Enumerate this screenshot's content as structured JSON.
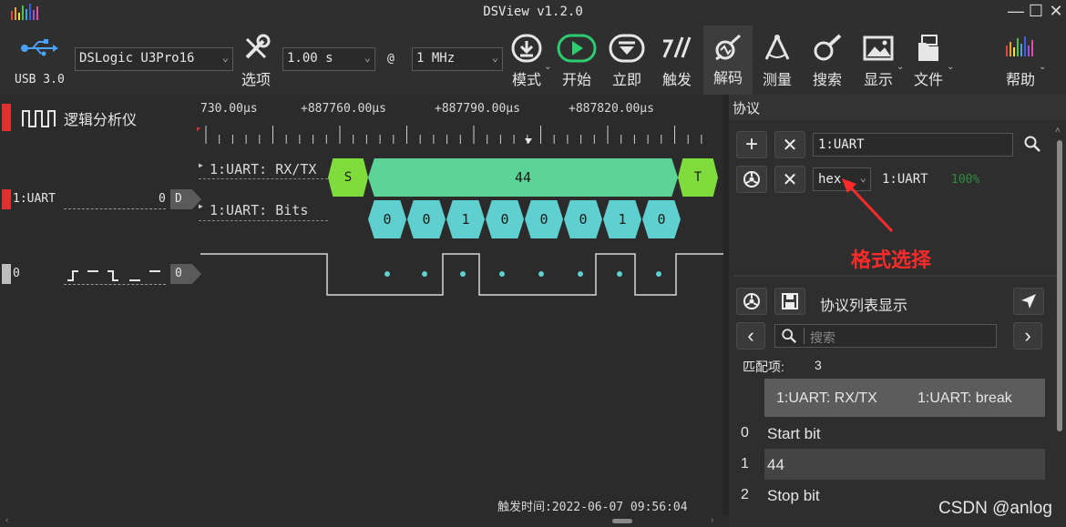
{
  "app": {
    "title": "DSView v1.2.0"
  },
  "toolbar": {
    "usb_label": "USB 3.0",
    "device": "DSLogic U3Pro16",
    "options_label": "选项",
    "duration": "1.00 s",
    "at": "@",
    "rate": "1 MHz",
    "mode_label": "模式",
    "start_label": "开始",
    "instant_label": "立即",
    "trigger_label": "触发",
    "decode_label": "解码",
    "measure_label": "测量",
    "search_label": "搜索",
    "display_label": "显示",
    "file_label": "文件",
    "help_label": "帮助"
  },
  "left": {
    "analyzer_label": "逻辑分析仪",
    "uart_label": "1:UART",
    "uart_value": "0",
    "uart_tag": "D",
    "ch0_label": "0",
    "ch0_tag": "0"
  },
  "ruler": {
    "labels": [
      "730.00μs",
      "+887760.00μs",
      "+887790.00μs",
      "+887820.00μs"
    ]
  },
  "decoder": {
    "rows": [
      "1:UART: RX/TX",
      "1:UART: Bits"
    ],
    "start": "S",
    "byte": "44",
    "stop": "T",
    "bits": [
      "0",
      "0",
      "1",
      "0",
      "0",
      "0",
      "1",
      "0"
    ]
  },
  "status": {
    "trigger_time": "触发时间:2022-06-07 09:56:04"
  },
  "protocol_panel": {
    "header": "协议",
    "decoder_name": "1:UART",
    "format": "hex",
    "decoder_label": "1:UART",
    "progress": "100%",
    "annotation": "格式选择",
    "list_title": "协议列表显示",
    "search_placeholder": "搜索",
    "match_label": "匹配项:",
    "match_count": "3",
    "columns": [
      "1:UART: RX/TX",
      "1:UART: break"
    ],
    "rows": [
      {
        "index": "0",
        "value": "Start bit"
      },
      {
        "index": "1",
        "value": "44"
      },
      {
        "index": "2",
        "value": "Stop bit"
      }
    ]
  },
  "watermark": "CSDN @anlog",
  "colors": {
    "accent_green": "#5cd498",
    "start_green": "#7fdc3c",
    "bits_cyan": "#5fd0cf",
    "marker_red": "#e03030",
    "annotation_red": "#ff2a2a"
  }
}
